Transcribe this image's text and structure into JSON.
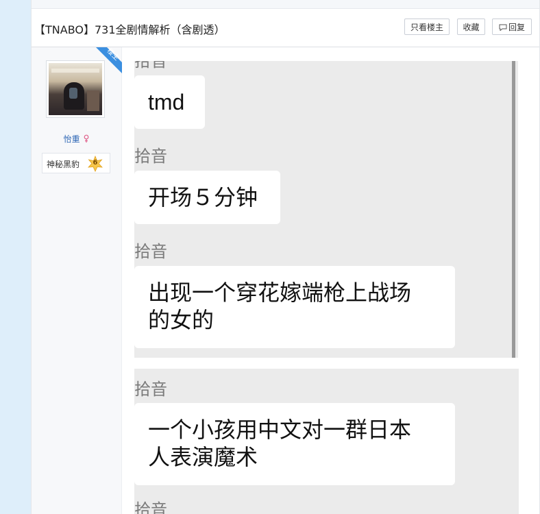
{
  "thread": {
    "title": "【TNABO】731全剧情解析（含剧透）",
    "buttons": {
      "only_op": "只看楼主",
      "favorite": "收藏",
      "reply": "回复"
    }
  },
  "post": {
    "op_badge": "楼主",
    "author": {
      "name": "怡重",
      "gender": "female",
      "level_title": "神秘黑豹",
      "level": "6"
    }
  },
  "chat_screenshots": [
    {
      "messages": [
        {
          "sender": "拾音",
          "text": "tmd"
        },
        {
          "sender": "拾音",
          "text": "开场５分钟"
        },
        {
          "sender": "拾音",
          "text": "出现一个穿花嫁端枪上战场\n的女的"
        }
      ]
    },
    {
      "messages": [
        {
          "sender": "拾音",
          "text": "一个小孩用中文对一群日本\n人表演魔术"
        },
        {
          "sender": "拾音",
          "text": ""
        }
      ]
    }
  ],
  "colors": {
    "link": "#2f67b5",
    "op_badge": "#3b8fe0",
    "page_bg": "#deeefa"
  }
}
